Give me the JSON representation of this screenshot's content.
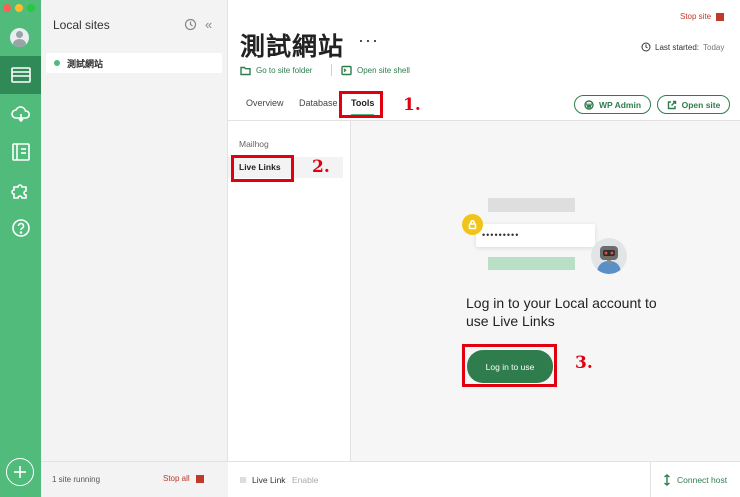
{
  "window": {
    "traffic_lights": [
      "#fe5f57",
      "#febc2e",
      "#28c840"
    ]
  },
  "rail": {
    "items": [
      {
        "icon": "sites-icon",
        "active": true
      },
      {
        "icon": "cloud-icon"
      },
      {
        "icon": "blueprint-icon"
      },
      {
        "icon": "addons-icon"
      },
      {
        "icon": "help-icon"
      }
    ],
    "accent": "#51bb7b"
  },
  "sites_panel": {
    "title": "Local sites",
    "sites": [
      {
        "name": "測試網站",
        "status": "running"
      }
    ],
    "footer": {
      "running_text": "1 site running",
      "stop_all_label": "Stop all"
    }
  },
  "header": {
    "site_title": "測試網站",
    "more_label": "···",
    "stop_site_label": "Stop site",
    "last_started_label": "Last started:",
    "last_started_value": "Today",
    "go_to_folder_label": "Go to site folder",
    "open_shell_label": "Open site shell"
  },
  "tabs": [
    {
      "label": "Overview"
    },
    {
      "label": "Database"
    },
    {
      "label": "Tools",
      "active": true
    }
  ],
  "actions": {
    "wp_admin_label": "WP Admin",
    "open_site_label": "Open site"
  },
  "tools_nav": [
    {
      "label": "Mailhog"
    },
    {
      "label": "Live Links",
      "active": true
    }
  ],
  "content": {
    "password_mask": "•••••••••",
    "message": "Log in to your Local account to use Live Links",
    "login_button": "Log in to use"
  },
  "bottom_bar": {
    "live_link_label": "Live Link",
    "enable_label": "Enable",
    "connect_host_label": "Connect host"
  },
  "annotations": {
    "step1": "1.",
    "step2": "2.",
    "step3": "3.",
    "color": "#e1000f"
  }
}
